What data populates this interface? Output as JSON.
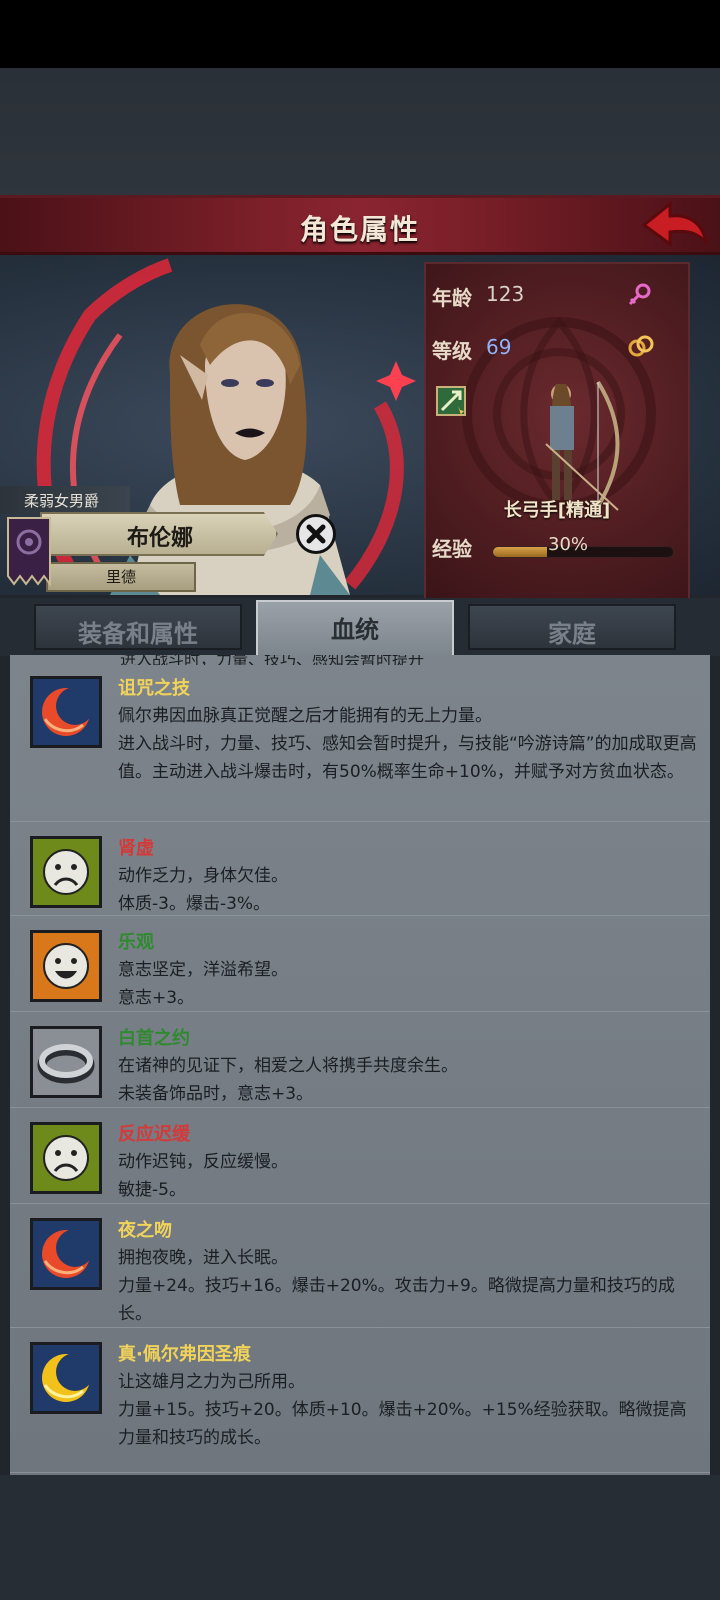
{
  "header": {
    "title": "角色属性"
  },
  "character": {
    "title": "柔弱女男爵",
    "name": "布伦娜",
    "family": "里德"
  },
  "stats": {
    "age_label": "年龄",
    "age": "123",
    "level_label": "等级",
    "level": "69",
    "class": "长弓手[精通]",
    "exp_label": "经验",
    "exp_percent": "30%",
    "exp_fraction": 0.3
  },
  "tabs": [
    {
      "label": "装备和属性",
      "active": false
    },
    {
      "label": "血统",
      "active": true
    },
    {
      "label": "家庭",
      "active": false
    }
  ],
  "traits": [
    {
      "name": "诅咒之技",
      "name_color": "#f2d35a",
      "icon": "red-crescent-icon",
      "desc": "佩尔弗因血脉真正觉醒之后才能拥有的无上力量。\n进入战斗时，力量、技巧、感知会暂时提升，与技能“吟游诗篇”的加成取更高值。主动进入战斗爆击时，有50%概率生命+10%，并赋予对方贫血状态。"
    },
    {
      "name": "肾虚",
      "name_color": "#d33a3a",
      "icon": "sad-face-icon",
      "desc": "动作乏力，身体欠佳。\n体质-3。爆击-3%。"
    },
    {
      "name": "乐观",
      "name_color": "#2f8a2f",
      "icon": "happy-face-icon",
      "desc": "意志坚定，洋溢希望。\n意志+3。"
    },
    {
      "name": "白首之约",
      "name_color": "#2f8a2f",
      "icon": "ring-icon",
      "desc": "在诸神的见证下，相爱之人将携手共度余生。\n未装备饰品时，意志+3。"
    },
    {
      "name": "反应迟缓",
      "name_color": "#d33a3a",
      "icon": "sad-face-icon",
      "desc": "动作迟钝，反应缓慢。\n敏捷-5。"
    },
    {
      "name": "夜之吻",
      "name_color": "#f2d35a",
      "icon": "red-crescent-icon",
      "desc": "拥抱夜晚，进入长眠。\n力量+24。技巧+16。爆击+20%。攻击力+9。略微提高力量和技巧的成长。"
    },
    {
      "name": "真·佩尔弗因圣痕",
      "name_color": "#f2d35a",
      "icon": "gold-crescent-icon",
      "desc": "让这雄月之力为己所用。\n力量+15。技巧+20。体质+10。爆击+20%。+15%经验获取。略微提高力量和技巧的成长。"
    }
  ],
  "clipped_line": "进入战斗时，力量、技巧、感知会暂时提升"
}
